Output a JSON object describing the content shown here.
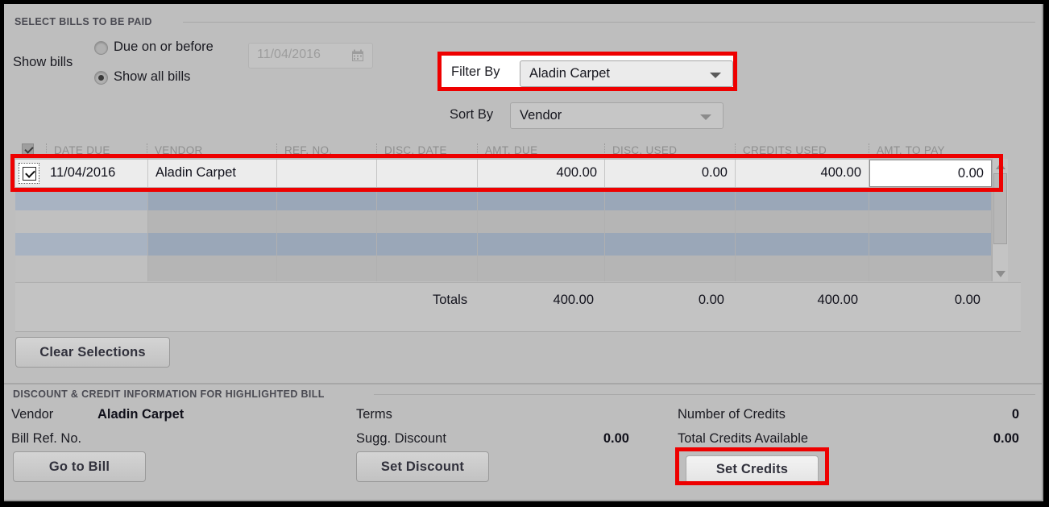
{
  "section_headers": {
    "select_bills": "SELECT BILLS TO BE PAID",
    "discount_credit": "DISCOUNT & CREDIT INFORMATION FOR HIGHLIGHTED BILL"
  },
  "show_bills": {
    "label": "Show bills",
    "option_due_on_before": "Due on or before",
    "option_show_all": "Show all bills",
    "selected": "Show all bills",
    "date_value": "11/04/2016",
    "date_enabled": false,
    "calendar_icon": "calendar-icon"
  },
  "filters": {
    "filter_by_label": "Filter By",
    "filter_by_value": "Aladin Carpet",
    "sort_by_label": "Sort By",
    "sort_by_value": "Vendor",
    "dropdown_icon": "chevron-down-icon"
  },
  "table": {
    "columns": [
      "DATE DUE",
      "VENDOR",
      "REF. NO.",
      "DISC. DATE",
      "AMT. DUE",
      "DISC. USED",
      "CREDITS USED",
      "AMT. TO PAY"
    ],
    "header_select_all_checked": true,
    "rows": [
      {
        "selected": true,
        "date_due": "11/04/2016",
        "vendor": "Aladin Carpet",
        "ref_no": "",
        "disc_date": "",
        "amt_due": "400.00",
        "disc_used": "0.00",
        "credits_used": "400.00",
        "amt_to_pay": "0.00"
      }
    ],
    "totals": {
      "label": "Totals",
      "amt_due": "400.00",
      "disc_used": "0.00",
      "credits_used": "400.00",
      "amt_to_pay": "0.00"
    },
    "scrollbar": {
      "up_icon": "scroll-up-arrow-icon",
      "down_icon": "scroll-down-arrow-icon"
    }
  },
  "buttons": {
    "clear_selections": "Clear Selections",
    "go_to_bill": "Go to Bill",
    "set_discount": "Set Discount",
    "set_credits": "Set Credits"
  },
  "detail": {
    "vendor_label": "Vendor",
    "vendor_value": "Aladin Carpet",
    "bill_ref_label": "Bill Ref. No.",
    "bill_ref_value": "",
    "terms_label": "Terms",
    "terms_value": "",
    "sugg_discount_label": "Sugg. Discount",
    "sugg_discount_value": "0.00",
    "number_of_credits_label": "Number of Credits",
    "number_of_credits_value": "0",
    "total_credits_label": "Total Credits Available",
    "total_credits_value": "0.00"
  },
  "annotations": {
    "highlight_color": "#ee0000",
    "boxes": [
      "filter-by-row",
      "selected-bill-row",
      "set-credits-button"
    ]
  }
}
